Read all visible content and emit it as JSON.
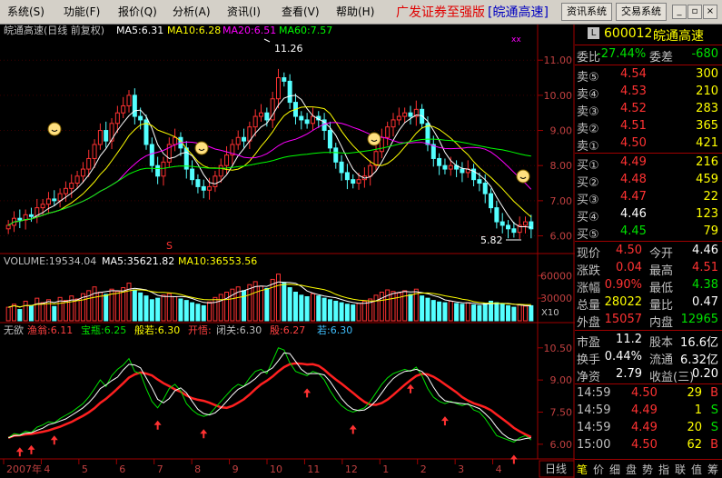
{
  "menu": {
    "items": [
      "系统(S)",
      "功能(F)",
      "报价(Q)",
      "分析(A)",
      "资讯(I)",
      "查看(V)",
      "帮助(H)"
    ],
    "title": "广发证券至强版",
    "stock_tag": "[皖通高速]",
    "btn_info": "资讯系统",
    "btn_trade": "交易系统"
  },
  "chart_header": {
    "name": "皖通高速(日线 前复权)",
    "ma5": "MA5:6.31",
    "ma10": "MA10:6.28",
    "ma20": "MA20:6.51",
    "ma60": "MA60:7.57",
    "high_label": "11.26",
    "low_label": "5.82",
    "s_mark": "S",
    "xx_mark": "xx"
  },
  "volume_header": {
    "vol": "VOLUME:19534.04",
    "ma5": "MA5:35621.82",
    "ma10": "MA10:36553.56",
    "unit": "X10"
  },
  "indicator_header": {
    "name": "无欲",
    "items": [
      {
        "label": "渔翁:6.11",
        "color": "#ff4040"
      },
      {
        "label": "宝瓶:6.25",
        "color": "#00e000"
      },
      {
        "label": "般若:6.30",
        "color": "#ffff00"
      },
      {
        "label": "开悟:",
        "color": "#ff4040"
      },
      {
        "label": "闭关:6.30",
        "color": "#c0c0c0"
      },
      {
        "label": "殷:6.27",
        "color": "#ff4040"
      },
      {
        "label": "若:6.30",
        "color": "#40c0ff"
      }
    ]
  },
  "x_axis": {
    "labels": [
      "2007年",
      "4",
      "5",
      "6",
      "7",
      "8",
      "9",
      "10",
      "11",
      "12",
      "1",
      "2",
      "3",
      "4"
    ],
    "period_btn": "日线"
  },
  "colors": {
    "up": "#ff3232",
    "down": "#54ffff",
    "ma5": "#ffffff",
    "ma10": "#ffff00",
    "ma20": "#ff00ff",
    "ma60": "#00ff00",
    "grid": "#8b0000"
  },
  "chart_data": {
    "type": "candlestick",
    "price_axis": {
      "ticks": [
        "11.00",
        "10.00",
        "9.00",
        "8.00",
        "7.00",
        "6.00"
      ],
      "range": [
        5.6,
        11.6
      ]
    },
    "volume_axis": {
      "ticks": [
        "60000",
        "30000"
      ],
      "range": [
        0,
        70000
      ]
    },
    "indicator_axis": {
      "ticks": [
        "10.50",
        "9.00",
        "7.50",
        "6.00"
      ],
      "range": [
        5.4,
        11.0
      ]
    },
    "close": [
      6.3,
      6.5,
      6.45,
      6.6,
      6.55,
      6.8,
      6.9,
      7.05,
      7.0,
      7.2,
      7.35,
      7.5,
      7.7,
      7.9,
      8.2,
      8.6,
      9.0,
      8.7,
      9.2,
      9.5,
      9.7,
      10.0,
      9.4,
      9.3,
      8.6,
      8.0,
      7.7,
      8.1,
      8.6,
      8.8,
      8.5,
      7.9,
      7.6,
      7.4,
      7.3,
      7.4,
      7.7,
      8.0,
      8.3,
      8.6,
      8.8,
      8.7,
      9.1,
      9.4,
      9.5,
      9.3,
      9.9,
      10.5,
      10.4,
      9.8,
      9.4,
      9.3,
      9.2,
      9.4,
      9.3,
      9.0,
      8.5,
      8.1,
      7.8,
      7.6,
      7.5,
      7.6,
      7.7,
      8.0,
      8.4,
      8.8,
      9.1,
      9.3,
      9.4,
      9.5,
      9.4,
      9.6,
      9.2,
      8.6,
      8.2,
      8.0,
      7.9,
      8.0,
      7.9,
      7.8,
      7.9,
      7.6,
      7.5,
      7.2,
      6.8,
      6.4,
      6.3,
      6.2,
      6.1,
      6.3,
      6.4,
      6.2
    ],
    "volume": [
      18000,
      22000,
      15000,
      26000,
      20000,
      30000,
      24000,
      28000,
      19000,
      31000,
      27000,
      33000,
      29000,
      36000,
      40000,
      45000,
      38000,
      35000,
      42000,
      39000,
      44000,
      50000,
      41000,
      37000,
      33000,
      28000,
      30000,
      34000,
      36000,
      32000,
      29000,
      27000,
      24000,
      22000,
      20000,
      25000,
      31000,
      35000,
      38000,
      42000,
      45000,
      40000,
      48000,
      52000,
      46000,
      43000,
      55000,
      62000,
      50000,
      44000,
      38000,
      34000,
      32000,
      36000,
      33000,
      30000,
      28000,
      26000,
      24000,
      22000,
      21000,
      23000,
      26000,
      29000,
      34000,
      38000,
      41000,
      39000,
      37000,
      40000,
      35000,
      42000,
      33000,
      30000,
      27000,
      25000,
      24000,
      26000,
      23000,
      22000,
      24000,
      21000,
      20000,
      23000,
      26000,
      24000,
      22000,
      20000,
      18000,
      21000,
      19534,
      20000
    ]
  },
  "quote": {
    "flag": "L",
    "code": "600012",
    "name": "皖通高速",
    "webi_label": "委比",
    "webi_value": "-27.44%",
    "weicha_label": "委差",
    "weicha_value": "-680",
    "sell": [
      {
        "label": "卖⑤",
        "price": "4.54",
        "vol": "300"
      },
      {
        "label": "卖④",
        "price": "4.53",
        "vol": "210"
      },
      {
        "label": "卖③",
        "price": "4.52",
        "vol": "283"
      },
      {
        "label": "卖②",
        "price": "4.51",
        "vol": "365"
      },
      {
        "label": "卖①",
        "price": "4.50",
        "vol": "421"
      }
    ],
    "buy": [
      {
        "label": "买①",
        "price": "4.49",
        "vol": "216",
        "pc": "#ff3232"
      },
      {
        "label": "买②",
        "price": "4.48",
        "vol": "459",
        "pc": "#ff3232"
      },
      {
        "label": "买③",
        "price": "4.47",
        "vol": "22",
        "pc": "#ff3232"
      },
      {
        "label": "买④",
        "price": "4.46",
        "vol": "123",
        "pc": "#ffffff"
      },
      {
        "label": "买⑤",
        "price": "4.45",
        "vol": "79",
        "pc": "#00e000"
      }
    ],
    "stats": [
      {
        "l1": "现价",
        "v1": "4.50",
        "c1": "#ff3232",
        "l2": "今开",
        "v2": "4.46",
        "c2": "#ffffff"
      },
      {
        "l1": "涨跌",
        "v1": "0.04",
        "c1": "#ff3232",
        "l2": "最高",
        "v2": "4.51",
        "c2": "#ff3232"
      },
      {
        "l1": "涨幅",
        "v1": "0.90%",
        "c1": "#ff3232",
        "l2": "最低",
        "v2": "4.38",
        "c2": "#00e000"
      },
      {
        "l1": "总量",
        "v1": "28022",
        "c1": "#ffff00",
        "l2": "量比",
        "v2": "0.47",
        "c2": "#ffffff"
      },
      {
        "l1": "外盘",
        "v1": "15057",
        "c1": "#ff3232",
        "l2": "内盘",
        "v2": "12965",
        "c2": "#00e000"
      }
    ],
    "fundamentals": [
      {
        "l1": "市盈",
        "v1": "11.2",
        "l2": "股本",
        "v2": "16.6亿"
      },
      {
        "l1": "换手",
        "v1": "0.44%",
        "l2": "流通",
        "v2": "6.32亿"
      },
      {
        "l1": "净资",
        "v1": "2.79",
        "l2": "收益(三)",
        "v2": "0.20"
      }
    ],
    "ticks": [
      {
        "time": "14:59",
        "price": "4.50",
        "vol": "29",
        "side": "B",
        "sc": "#ff3232"
      },
      {
        "time": "14:59",
        "price": "4.49",
        "vol": "1",
        "side": "S",
        "sc": "#00e000"
      },
      {
        "time": "14:59",
        "price": "4.49",
        "vol": "20",
        "side": "S",
        "sc": "#00e000"
      },
      {
        "time": "15:00",
        "price": "4.50",
        "vol": "62",
        "side": "B",
        "sc": "#ff3232"
      }
    ],
    "tabs": [
      "笔",
      "价",
      "细",
      "盘",
      "势",
      "指",
      "联",
      "值",
      "筹"
    ]
  }
}
